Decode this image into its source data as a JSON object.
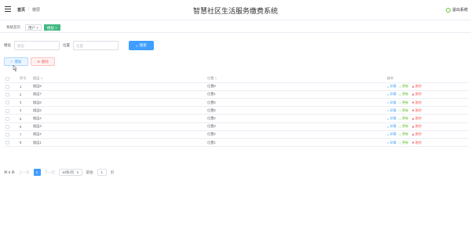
{
  "header": {
    "breadcrumb_home": "首页",
    "breadcrumb_sep": "/",
    "breadcrumb_current": "楼层",
    "title": "智慧社区生活服务缴费系统",
    "logout": "退出系统"
  },
  "tabs": {
    "home": "系统首页",
    "users": "用户 ×",
    "floors": "楼层 ×"
  },
  "search": {
    "name_label": "楼层",
    "name_placeholder": "楼层",
    "name_value": "",
    "pos_label": "位置",
    "pos_placeholder": "位置",
    "pos_value": "",
    "button": "搜索"
  },
  "ops": {
    "add": "增加",
    "delete": "删除"
  },
  "table": {
    "headers": {
      "index": "序号",
      "name": "楼层",
      "pos": "位置",
      "actions": "操作"
    },
    "rows": [
      {
        "index": "1",
        "name": "楼层8",
        "pos": "位置8"
      },
      {
        "index": "2",
        "name": "楼层7",
        "pos": "位置1"
      },
      {
        "index": "3",
        "name": "楼层6",
        "pos": "位置6"
      },
      {
        "index": "4",
        "name": "楼层5",
        "pos": "位置5"
      },
      {
        "index": "5",
        "name": "楼层4",
        "pos": "位置4"
      },
      {
        "index": "6",
        "name": "楼层3",
        "pos": "位置3"
      },
      {
        "index": "7",
        "name": "楼层2",
        "pos": "位置2"
      },
      {
        "index": "8",
        "name": "楼层1",
        "pos": "位置1"
      }
    ],
    "action_labels": {
      "detail": "详情",
      "edit": "更新",
      "delete": "删除"
    }
  },
  "pager": {
    "total": "共 8 条",
    "prev": "上一页",
    "current": "1",
    "next": "下一页",
    "size": "10条/页",
    "goto_label": "前往",
    "goto_value": "1",
    "page_unit": "页"
  },
  "icons": {
    "search": "search-icon",
    "add": "plus-icon",
    "delete": "x-icon",
    "detail": "magnifier-icon",
    "edit": "edit-icon",
    "logout": "power-icon"
  },
  "colors": {
    "primary": "#409eff",
    "success": "#67c23a",
    "danger": "#f56c6c",
    "active_tag": "#42b983"
  }
}
